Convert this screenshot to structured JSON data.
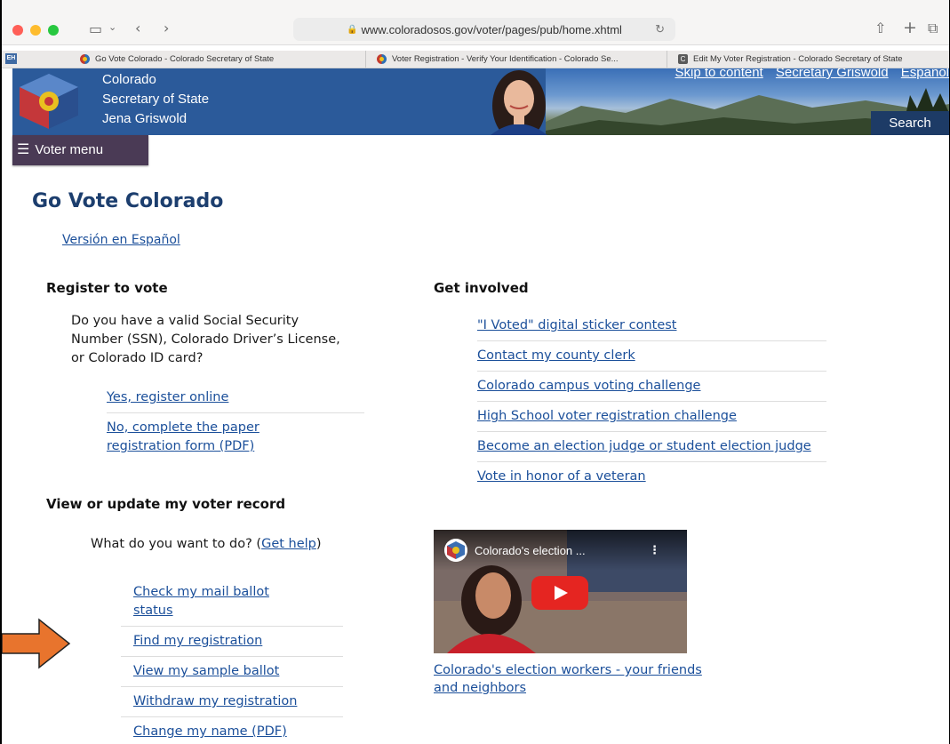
{
  "browser": {
    "url": "www.coloradosos.gov/voter/pages/pub/home.xhtml",
    "tabs": [
      {
        "label": "Go Vote Colorado - Colorado Secretary of State",
        "favicon": "colorado-flag-icon",
        "active": true
      },
      {
        "label": "Voter Registration - Verify Your Identification - Colorado Se...",
        "favicon": "colorado-flag-icon",
        "active": false
      },
      {
        "label": "Edit My Voter Registration - Colorado Secretary of State",
        "favicon": "c-letter-icon",
        "active": false
      }
    ],
    "tab_overflow_badge": "EH"
  },
  "header": {
    "brand_line1": "Colorado",
    "brand_line2": "Secretary of State",
    "brand_line3": "Jena Griswold",
    "top_links": [
      "Skip to content",
      "Secretary Griswold",
      "Español"
    ],
    "search_label": "Search",
    "menu_label": "Voter menu"
  },
  "main": {
    "title": "Go Vote Colorado",
    "spanish_link": "Versión en Español",
    "register": {
      "heading": "Register to vote",
      "question": "Do you have a valid Social Security Number (SSN), Colorado Driver’s License, or Colorado ID card?",
      "links": [
        "Yes, register online",
        "No, complete the paper registration form (PDF)"
      ]
    },
    "record": {
      "heading": "View or update my voter record",
      "question_prefix": "What do you want to do? (",
      "help_link": "Get help",
      "question_suffix": ")",
      "links": [
        "Check my mail ballot status",
        "Find my registration",
        "View my sample ballot",
        "Withdraw my registration",
        "Change my name (PDF)"
      ]
    },
    "involved": {
      "heading": "Get involved",
      "links": [
        "\"I Voted\" digital sticker contest",
        "Contact my county clerk",
        "Colorado campus voting challenge",
        "High School voter registration challenge",
        "Become an election judge or student election judge",
        "Vote in honor of a veteran"
      ]
    },
    "video": {
      "title": "Colorado's election ...",
      "caption": "Colorado's election workers - your friends and neighbors"
    }
  },
  "colors": {
    "banner_blue": "#2b5a9a",
    "menu_purple": "#4a3a55",
    "title_navy": "#1c3e6e",
    "link_blue": "#1b4f9a",
    "annotation_arrow": "#e8742d"
  }
}
